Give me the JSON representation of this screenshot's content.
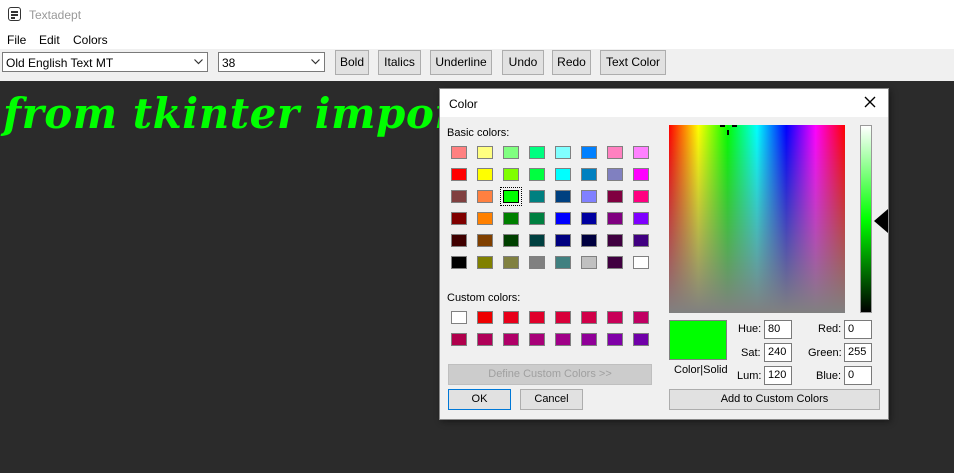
{
  "window": {
    "title": "Textadept"
  },
  "menu": {
    "items": [
      "File",
      "Edit",
      "Colors"
    ]
  },
  "toolbar": {
    "font_value": "Old English Text MT",
    "size_value": "38",
    "buttons": [
      "Bold",
      "Italics",
      "Underline",
      "Undo",
      "Redo",
      "Text Color"
    ]
  },
  "editor": {
    "text": "from tkinter import *",
    "text_color": "#00ff00",
    "background": "#2b2b2b"
  },
  "color_dialog": {
    "title": "Color",
    "basic_colors_label": "Basic colors:",
    "custom_colors_label": "Custom colors:",
    "basic_colors": [
      [
        "#ff8080",
        "#ffff80",
        "#80ff80",
        "#00ff80",
        "#80ffff",
        "#0080ff",
        "#ff80c0",
        "#ff80ff"
      ],
      [
        "#ff0000",
        "#ffff00",
        "#80ff00",
        "#00ff40",
        "#00ffff",
        "#0080c0",
        "#8080c0",
        "#ff00ff"
      ],
      [
        "#804040",
        "#ff8040",
        "#00ff00",
        "#008080",
        "#004080",
        "#8080ff",
        "#800040",
        "#ff0080"
      ],
      [
        "#800000",
        "#ff8000",
        "#008000",
        "#008040",
        "#0000ff",
        "#0000a0",
        "#800080",
        "#8000ff"
      ],
      [
        "#400000",
        "#804000",
        "#004000",
        "#004040",
        "#000080",
        "#000040",
        "#400040",
        "#400080"
      ],
      [
        "#000000",
        "#808000",
        "#808040",
        "#808080",
        "#408080",
        "#c0c0c0",
        "#400040",
        "#ffffff"
      ]
    ],
    "custom_colors": [
      [
        "#ffffff",
        "#ee0000",
        "#e8001a",
        "#e0002a",
        "#d8003a",
        "#d00048",
        "#c80058",
        "#c00062"
      ],
      [
        "#b0004c",
        "#b00058",
        "#b00068",
        "#a80078",
        "#a00088",
        "#900098",
        "#8000a8",
        "#7000a8"
      ]
    ],
    "define_custom_label": "Define Custom Colors >>",
    "ok_label": "OK",
    "cancel_label": "Cancel",
    "color_solid_label": "Color|Solid",
    "add_custom_label": "Add to Custom Colors",
    "hue_label": "Hue:",
    "hue_value": "80",
    "sat_label": "Sat:",
    "sat_value": "240",
    "lum_label": "Lum:",
    "lum_value": "120",
    "red_label": "Red:",
    "red_value": "0",
    "green_label": "Green:",
    "green_value": "255",
    "blue_label": "Blue:",
    "blue_value": "0",
    "selected_color": "#00ff00"
  }
}
